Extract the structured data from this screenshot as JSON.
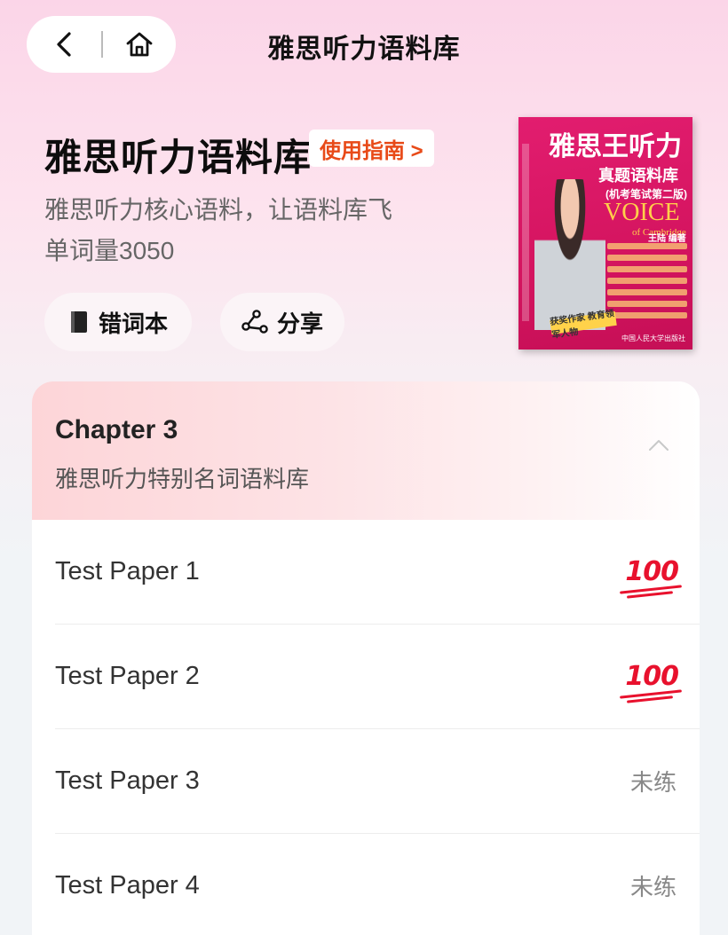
{
  "nav": {
    "back_icon": "chevron-left-icon",
    "home_icon": "home-icon",
    "title": "雅思听力语料库"
  },
  "header": {
    "title": "雅思听力语料库",
    "guide_label": "使用指南 >",
    "subtitle": "雅思听力核心语料，让语料库飞单词量3050",
    "actions": [
      {
        "label": "错词本",
        "icon": "book-icon"
      },
      {
        "label": "分享",
        "icon": "share-icon"
      }
    ]
  },
  "book_cover": {
    "title": "雅思王听力",
    "subtitle": "真题语料库",
    "edition": "(机考笔试第二版)",
    "brand": "VOICE",
    "brand_sub": "of Cambridge",
    "author": "王陆 编著",
    "sticker": "获奖作家 教育领军人物",
    "publisher": "中国人民大学出版社"
  },
  "chapter": {
    "title": "Chapter 3",
    "description": "雅思听力特别名词语料库",
    "toggle_icon": "chevron-up-icon"
  },
  "papers": [
    {
      "name": "Test Paper 1",
      "status": "100",
      "status_type": "score-icon"
    },
    {
      "name": "Test Paper 2",
      "status": "100",
      "status_type": "score-icon"
    },
    {
      "name": "Test Paper 3",
      "status": "未练",
      "status_type": "text"
    },
    {
      "name": "Test Paper 4",
      "status": "未练",
      "status_type": "text"
    }
  ],
  "colors": {
    "accent": "#e84a18",
    "score_red": "#e8112d",
    "cover_pink": "#d4145f"
  }
}
